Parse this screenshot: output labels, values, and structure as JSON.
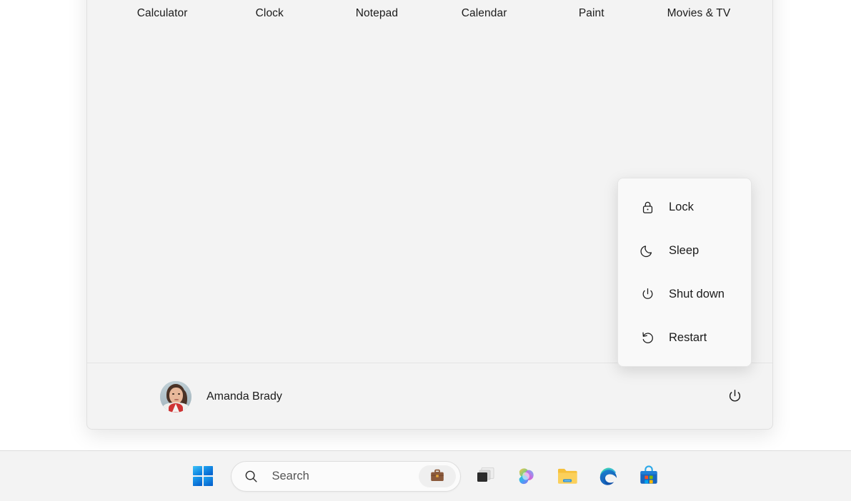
{
  "start_menu": {
    "pinned_apps": [
      {
        "label": "Calculator",
        "icon": "calculator-icon"
      },
      {
        "label": "Clock",
        "icon": "clock-icon"
      },
      {
        "label": "Notepad",
        "icon": "notepad-icon"
      },
      {
        "label": "Calendar",
        "icon": "calendar-icon"
      },
      {
        "label": "Paint",
        "icon": "paint-icon"
      },
      {
        "label": "Movies & TV",
        "icon": "movies-tv-icon"
      }
    ],
    "account": {
      "name": "Amanda Brady",
      "avatar_icon": "user-avatar-photo",
      "power_icon": "power-icon"
    }
  },
  "power_flyout": {
    "items": [
      {
        "label": "Lock",
        "icon": "lock-icon"
      },
      {
        "label": "Sleep",
        "icon": "moon-icon"
      },
      {
        "label": "Shut down",
        "icon": "power-icon"
      },
      {
        "label": "Restart",
        "icon": "restart-icon"
      }
    ]
  },
  "taskbar": {
    "start_button": {
      "label": "Start",
      "icon": "windows-logo-icon"
    },
    "search": {
      "placeholder": "Search",
      "icon": "search-icon",
      "badge_icon": "briefcase-icon"
    },
    "buttons": [
      {
        "label": "Task View",
        "icon": "task-view-icon"
      },
      {
        "label": "Copilot",
        "icon": "copilot-icon"
      },
      {
        "label": "File Explorer",
        "icon": "file-explorer-icon"
      },
      {
        "label": "Microsoft Edge",
        "icon": "edge-icon"
      },
      {
        "label": "Microsoft Store",
        "icon": "microsoft-store-icon"
      }
    ]
  },
  "colors": {
    "panel_bg": "#f3f3f3",
    "flyout_bg": "#f9f9f9",
    "taskbar_bg": "#f3f3f3",
    "text": "#1b1b1b",
    "accent_blue": "#0f87e8"
  }
}
